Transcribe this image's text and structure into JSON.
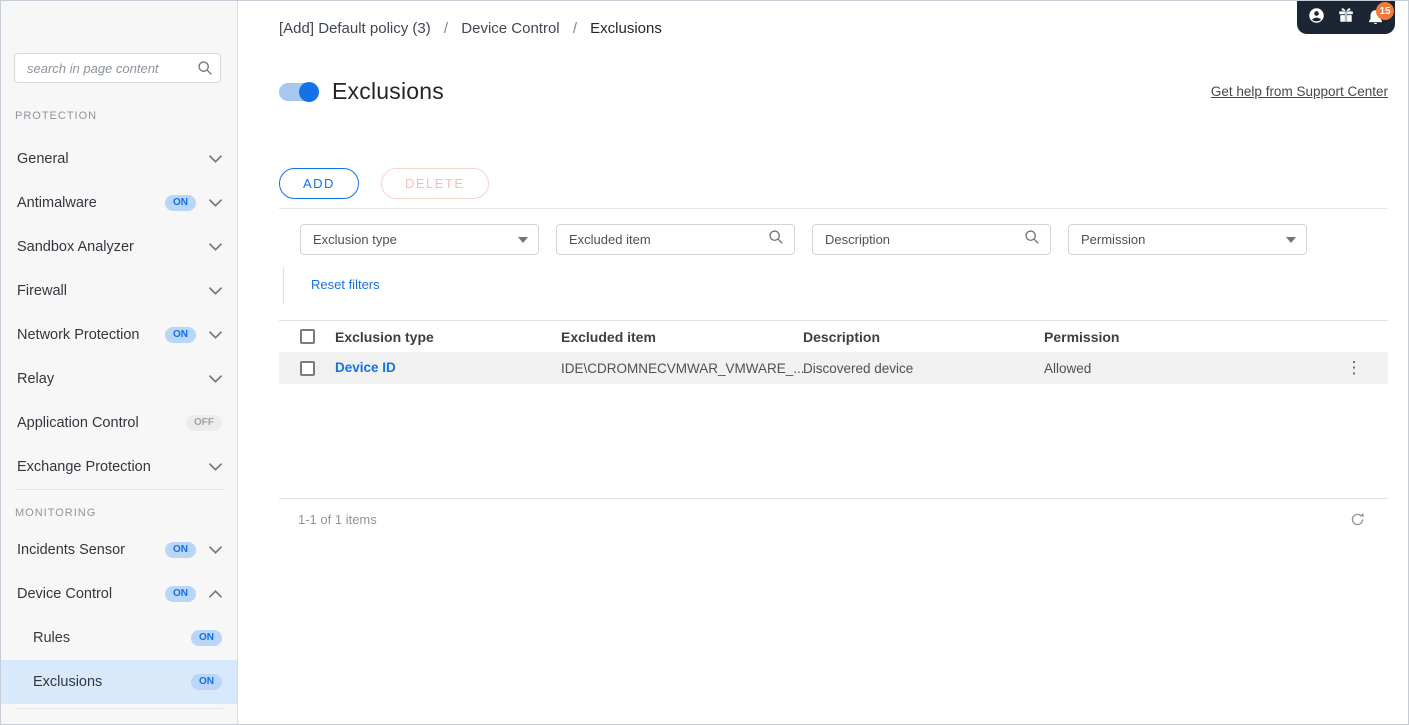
{
  "colors": {
    "accent": "#1373e6",
    "link": "#1373e6",
    "sidebar_bg": "#f7f7f8",
    "sidebar_selected_bg": "#d9e9fc",
    "badge_on_bg": "#b9d6f8",
    "badge_on_text": "#1270e3",
    "badge_off_bg": "#ececec",
    "badge_off_text": "#a0a4aa",
    "dark_bar": "#1c2533",
    "notification_badge": "#f2793a",
    "delete_disabled_border": "#f7d2cf",
    "delete_disabled_text": "#f5bdb9",
    "table_row_bg": "#f1f1f2"
  },
  "topbar": {
    "notification_count": "15"
  },
  "sidebar": {
    "search_placeholder": "search in page content",
    "protection": {
      "label": "PROTECTION",
      "items": [
        {
          "label": "General"
        },
        {
          "label": "Antimalware",
          "badge": "ON"
        },
        {
          "label": "Sandbox Analyzer"
        },
        {
          "label": "Firewall"
        },
        {
          "label": "Network Protection",
          "badge": "ON"
        },
        {
          "label": "Relay"
        },
        {
          "label": "Application Control",
          "badge": "OFF"
        },
        {
          "label": "Exchange Protection"
        }
      ]
    },
    "monitoring": {
      "label": "MONITORING",
      "items": [
        {
          "label": "Incidents Sensor",
          "badge": "ON"
        },
        {
          "label": "Device Control",
          "badge": "ON"
        },
        {
          "label": "Rules",
          "badge": "ON"
        },
        {
          "label": "Exclusions",
          "badge": "ON"
        }
      ]
    }
  },
  "breadcrumb": {
    "separator": "/",
    "items": [
      "[Add] Default policy (3)",
      "Device Control",
      "Exclusions"
    ]
  },
  "header": {
    "title": "Exclusions",
    "toggle_state": "on",
    "help_link": "Get help from Support Center"
  },
  "toolbar": {
    "add_label": "ADD",
    "delete_label": "DELETE"
  },
  "filters": {
    "exclusion_type": {
      "placeholder": "Exclusion type"
    },
    "excluded_item": {
      "placeholder": "Excluded item"
    },
    "description": {
      "placeholder": "Description"
    },
    "permission": {
      "placeholder": "Permission"
    },
    "reset_label": "Reset filters"
  },
  "table": {
    "columns": [
      "Exclusion type",
      "Excluded item",
      "Description",
      "Permission"
    ],
    "rows": [
      {
        "exclusion_type": "Device ID",
        "excluded_item": "IDE\\CDROMNECVMWAR_VMWARE_...",
        "description": "Discovered device",
        "permission": "Allowed"
      }
    ]
  },
  "footer": {
    "items_summary": "1-1 of 1 items"
  },
  "icons": {
    "kebab_glyph": "⋮"
  }
}
